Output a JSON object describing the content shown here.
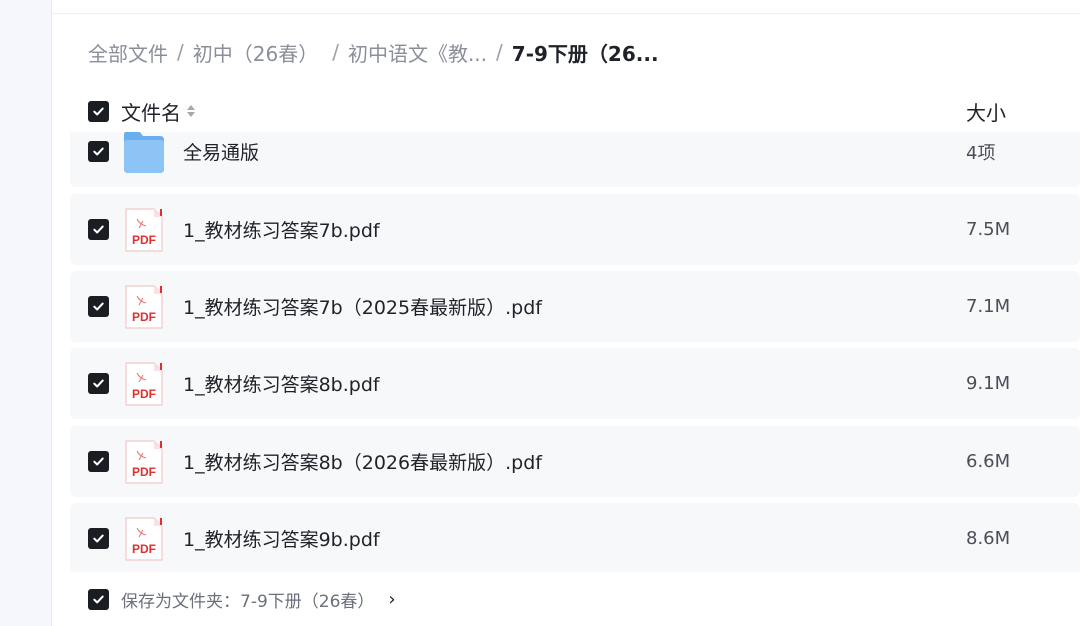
{
  "breadcrumb": [
    {
      "label": "全部文件"
    },
    {
      "label": "初中（26春）"
    },
    {
      "label": "初中语文《教..."
    },
    {
      "label": "7-9下册（26..."
    }
  ],
  "header": {
    "name_label": "文件名",
    "size_label": "大小"
  },
  "files": [
    {
      "name": "全易通版",
      "size": "4项",
      "icon": "folder-icon"
    },
    {
      "name": "1_教材练习答案7b.pdf",
      "size": "7.5M",
      "icon": "pdf-icon"
    },
    {
      "name": "1_教材练习答案7b（2025春最新版）.pdf",
      "size": "7.1M",
      "icon": "pdf-icon"
    },
    {
      "name": "1_教材练习答案8b.pdf",
      "size": "9.1M",
      "icon": "pdf-icon"
    },
    {
      "name": "1_教材练习答案8b（2026春最新版）.pdf",
      "size": "6.6M",
      "icon": "pdf-icon"
    },
    {
      "name": "1_教材练习答案9b.pdf",
      "size": "8.6M",
      "icon": "pdf-icon"
    }
  ],
  "pdf_badge": "PDF",
  "footer": {
    "save_text": "保存为文件夹：7-9下册（26春）",
    "chevron": "›"
  },
  "colors": {
    "checkbox": "#1a1d22",
    "row_bg": "#f7f8fa",
    "pdf_red": "#e02f2f",
    "folder_blue": "#74b4f2"
  }
}
